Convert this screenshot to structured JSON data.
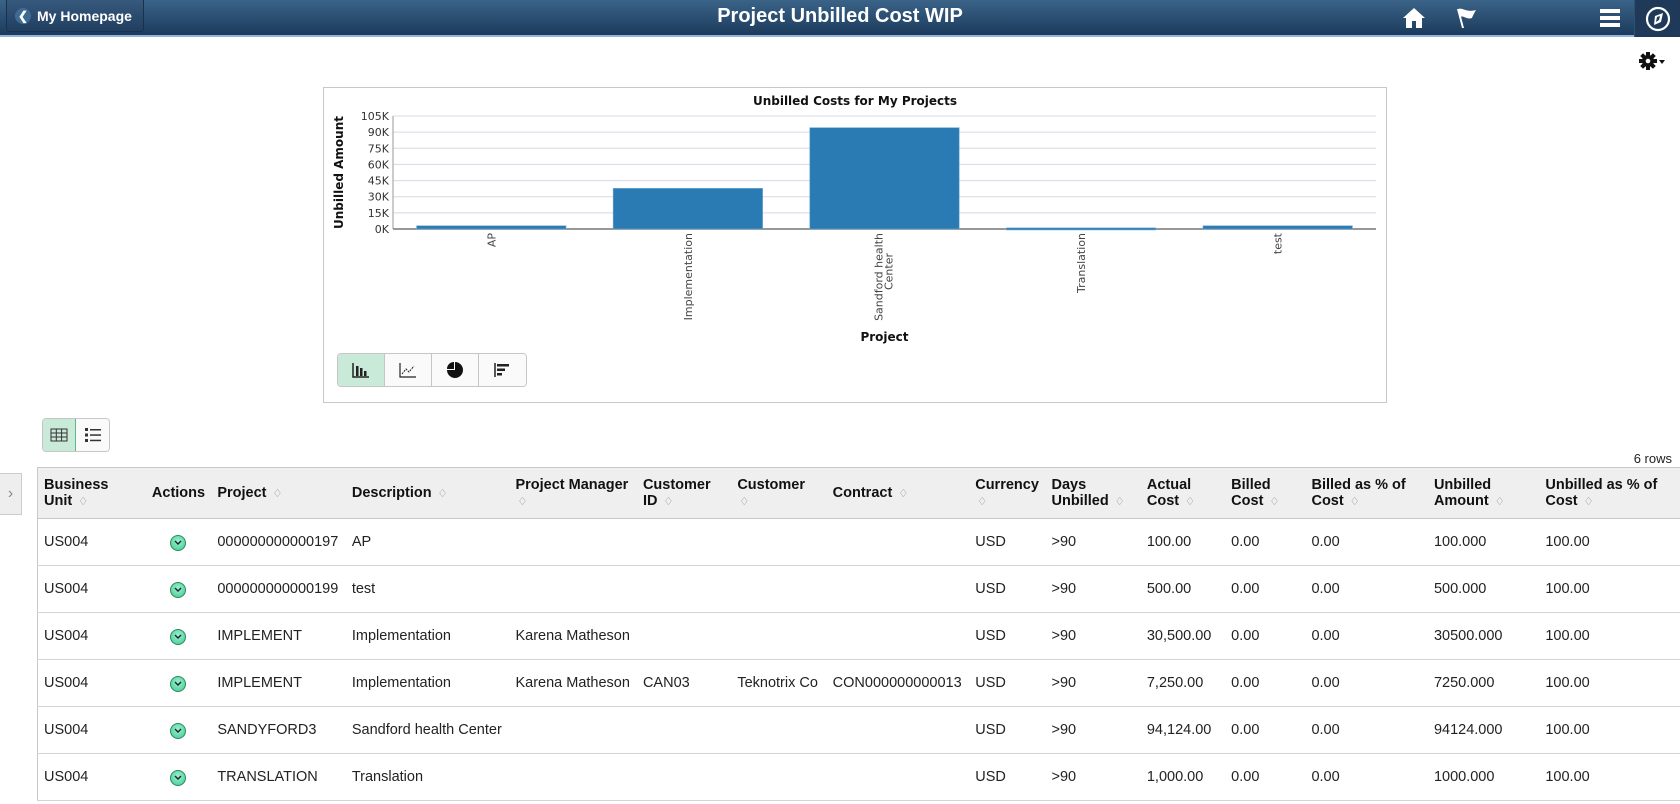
{
  "header": {
    "back_label": "My Homepage",
    "title": "Project Unbilled Cost WIP",
    "icons": [
      "home-icon",
      "flag-icon",
      "menu-icon",
      "navbar-compass-icon"
    ]
  },
  "settings_icon": "gear-icon",
  "chart_data": {
    "type": "bar",
    "title": "Unbilled Costs for My Projects",
    "xlabel": "Project",
    "ylabel": "Unbilled Amount",
    "categories": [
      "AP",
      "Implementation",
      "Sandford health Center",
      "Translation",
      "test"
    ],
    "values": [
      3000,
      37750,
      94124,
      1000,
      3000
    ],
    "ylim": [
      0,
      105000
    ],
    "yticks": [
      "0K",
      "15K",
      "30K",
      "45K",
      "60K",
      "75K",
      "90K",
      "105K"
    ],
    "grid": true,
    "legend": "none",
    "color": "#2a7ab4"
  },
  "chart_types": [
    {
      "name": "bar-chart",
      "active": true
    },
    {
      "name": "line-chart",
      "active": false
    },
    {
      "name": "pie-chart",
      "active": false
    },
    {
      "name": "horizontal-bar-chart",
      "active": false
    }
  ],
  "view_toggle": [
    {
      "name": "grid-view",
      "active": true
    },
    {
      "name": "list-view",
      "active": false
    }
  ],
  "table": {
    "row_count_label": "6 rows",
    "columns": [
      {
        "label": "Business Unit",
        "sortable": true
      },
      {
        "label": "Actions",
        "sortable": false
      },
      {
        "label": "Project",
        "sortable": true
      },
      {
        "label": "Description",
        "sortable": true
      },
      {
        "label": "Project Manager",
        "sortable": true
      },
      {
        "label": "Customer ID",
        "sortable": true
      },
      {
        "label": "Customer",
        "sortable": true
      },
      {
        "label": "Contract",
        "sortable": true
      },
      {
        "label": "Currency",
        "sortable": true
      },
      {
        "label": "Days Unbilled",
        "sortable": true
      },
      {
        "label": "Actual Cost",
        "sortable": true
      },
      {
        "label": "Billed Cost",
        "sortable": true
      },
      {
        "label": "Billed as % of Cost",
        "sortable": true
      },
      {
        "label": "Unbilled Amount",
        "sortable": true
      },
      {
        "label": "Unbilled as % of Cost",
        "sortable": true
      }
    ],
    "rows": [
      [
        "US004",
        "",
        "000000000000197",
        "AP",
        "",
        "",
        "",
        "",
        "USD",
        ">90",
        "100.00",
        "0.00",
        "0.00",
        "100.000",
        "100.00"
      ],
      [
        "US004",
        "",
        "000000000000199",
        "test",
        "",
        "",
        "",
        "",
        "USD",
        ">90",
        "500.00",
        "0.00",
        "0.00",
        "500.000",
        "100.00"
      ],
      [
        "US004",
        "",
        "IMPLEMENT",
        "Implementation",
        "Karena Matheson",
        "",
        "",
        "",
        "USD",
        ">90",
        "30,500.00",
        "0.00",
        "0.00",
        "30500.000",
        "100.00"
      ],
      [
        "US004",
        "",
        "IMPLEMENT",
        "Implementation",
        "Karena Matheson",
        "CAN03",
        "Teknotrix Co",
        "CON000000000013",
        "USD",
        ">90",
        "7,250.00",
        "0.00",
        "0.00",
        "7250.000",
        "100.00"
      ],
      [
        "US004",
        "",
        "SANDYFORD3",
        "Sandford health Center",
        "",
        "",
        "",
        "",
        "USD",
        ">90",
        "94,124.00",
        "0.00",
        "0.00",
        "94124.000",
        "100.00"
      ],
      [
        "US004",
        "",
        "TRANSLATION",
        "Translation",
        "",
        "",
        "",
        "",
        "USD",
        ">90",
        "1,000.00",
        "0.00",
        "0.00",
        "1000.000",
        "100.00"
      ]
    ]
  }
}
